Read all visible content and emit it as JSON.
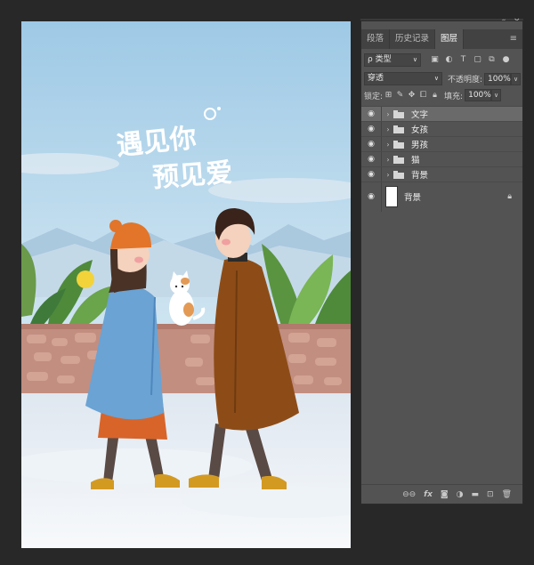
{
  "canvas": {
    "title_line1": "遇见你",
    "title_line2": "预见爱"
  },
  "panel": {
    "collapse_icon": "«",
    "close_icon": "×",
    "tabs": [
      {
        "label": "段落"
      },
      {
        "label": "历史记录"
      },
      {
        "label": "图层"
      }
    ],
    "menu_icon": "≡",
    "filter": {
      "value": "ρ 类型",
      "icons": [
        "image-filter-icon",
        "adjustment-filter-icon",
        "type-filter-icon",
        "shape-filter-icon",
        "smart-object-filter-icon"
      ]
    },
    "blend": {
      "mode": "穿透",
      "opacity_label": "不透明度:",
      "opacity_value": "100%"
    },
    "lock": {
      "label": "锁定:",
      "fill_label": "填充:",
      "fill_value": "100%"
    },
    "layers": [
      {
        "name": "文字",
        "type": "group",
        "selected": true
      },
      {
        "name": "女孩",
        "type": "group",
        "selected": false
      },
      {
        "name": "男孩",
        "type": "group",
        "selected": false
      },
      {
        "name": "猫",
        "type": "group",
        "selected": false
      },
      {
        "name": "背景",
        "type": "group",
        "selected": false
      },
      {
        "name": "背景",
        "type": "background",
        "locked": true
      }
    ],
    "bottom_icons": [
      "link-icon",
      "fx-icon",
      "mask-icon",
      "adjustment-icon",
      "group-icon",
      "new-layer-icon",
      "trash-icon"
    ]
  }
}
